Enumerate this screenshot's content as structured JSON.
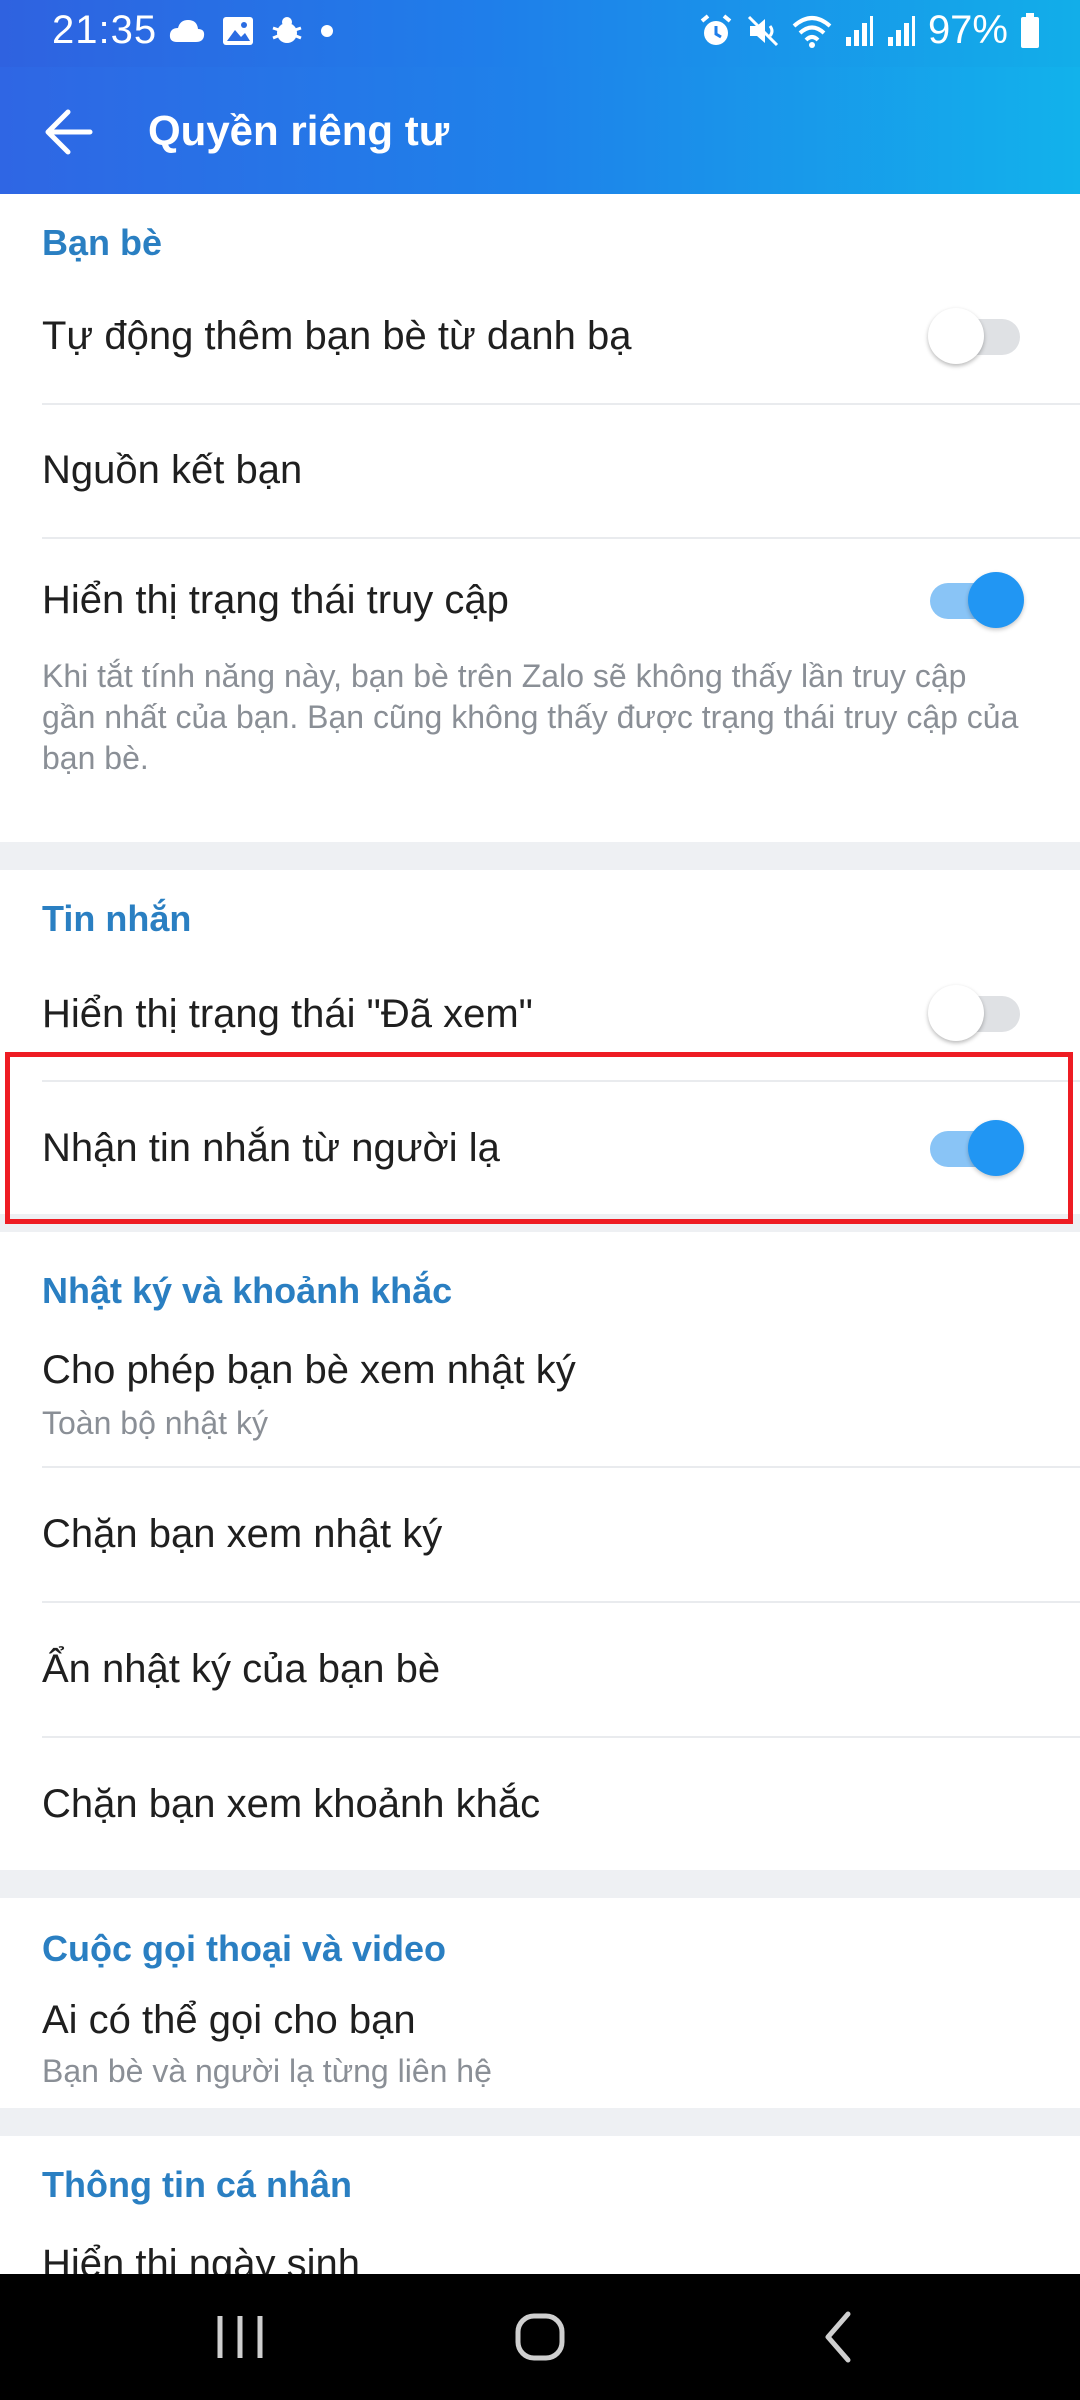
{
  "status_bar": {
    "time": "21:35",
    "battery": "97%",
    "left_icons": [
      "cloud-icon",
      "image-icon",
      "bug-icon",
      "dot-icon"
    ],
    "right_icons": [
      "alarm-icon",
      "mute-icon",
      "wifi-icon",
      "signal-icon",
      "signal-icon",
      "battery-icon"
    ]
  },
  "app_bar": {
    "title": "Quyền riêng tư",
    "back_icon": "arrow-left-icon"
  },
  "sections": {
    "friends": {
      "title": "Bạn bè",
      "auto_add": {
        "label": "Tự động thêm bạn bè từ danh bạ",
        "enabled": false
      },
      "friend_source": {
        "label": "Nguồn kết bạn"
      },
      "show_access": {
        "label": "Hiển thị trạng thái truy cập",
        "enabled": true,
        "description": "Khi tắt tính năng này, bạn bè trên Zalo sẽ không thấy lần truy cập gần nhất của bạn. Bạn cũng không thấy được trạng thái truy cập của bạn bè."
      }
    },
    "messages": {
      "title": "Tin nhắn",
      "show_seen": {
        "label": "Hiển thị trạng thái \"Đã xem\"",
        "enabled": false
      },
      "from_strangers": {
        "label": "Nhận tin nhắn từ người lạ",
        "enabled": true
      }
    },
    "diary": {
      "title": "Nhật ký và khoảnh khắc",
      "allow_view": {
        "label": "Cho phép bạn bè xem nhật ký",
        "value": "Toàn bộ nhật ký"
      },
      "block_view": {
        "label": "Chặn bạn xem nhật ký"
      },
      "hide_friends": {
        "label": "Ẩn nhật ký của bạn bè"
      },
      "block_moments": {
        "label": "Chặn bạn xem khoảnh khắc"
      }
    },
    "calls": {
      "title": "Cuộc gọi thoại và video",
      "who_can_call": {
        "label": "Ai có thể gọi cho bạn",
        "value": "Bạn bè và người lạ từng liên hệ"
      }
    },
    "personal": {
      "title": "Thông tin cá nhân",
      "show_birthday": {
        "label": "Hiển thị ngày sinh"
      }
    }
  },
  "colors": {
    "accent": "#2196f3",
    "section_title": "#2a7fc2",
    "highlight_border": "#ee1c23"
  },
  "nav_bar": {
    "icons": [
      "recent-apps-icon",
      "home-icon",
      "back-icon"
    ]
  }
}
